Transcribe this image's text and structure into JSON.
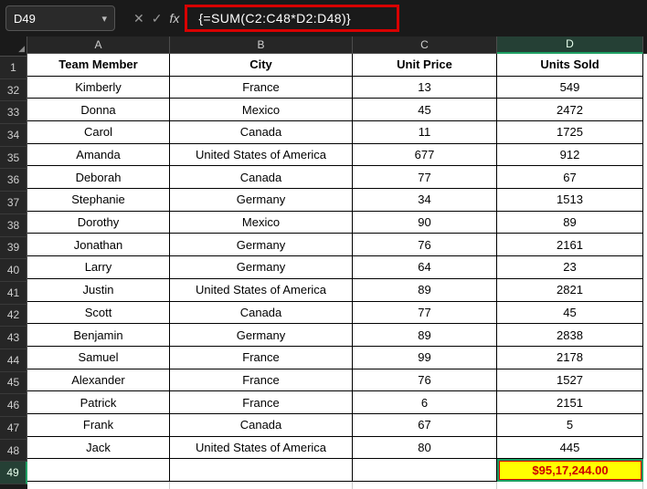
{
  "name_box": "D49",
  "fx_label": "fx",
  "formula": "{=SUM(C2:C48*D2:D48)}",
  "col_letters": [
    "A",
    "B",
    "C",
    "D"
  ],
  "row_header_first": "1",
  "row_headers_rest": [
    "32",
    "33",
    "34",
    "35",
    "36",
    "37",
    "38",
    "39",
    "40",
    "41",
    "42",
    "43",
    "44",
    "45",
    "46",
    "47",
    "48",
    "49"
  ],
  "table_headers": {
    "a": "Team Member",
    "b": "City",
    "c": "Unit Price",
    "d": "Units Sold"
  },
  "rows": [
    {
      "a": "Kimberly",
      "b": "France",
      "c": "13",
      "d": "549"
    },
    {
      "a": "Donna",
      "b": "Mexico",
      "c": "45",
      "d": "2472"
    },
    {
      "a": "Carol",
      "b": "Canada",
      "c": "11",
      "d": "1725"
    },
    {
      "a": "Amanda",
      "b": "United States of America",
      "c": "677",
      "d": "912"
    },
    {
      "a": "Deborah",
      "b": "Canada",
      "c": "77",
      "d": "67"
    },
    {
      "a": "Stephanie",
      "b": "Germany",
      "c": "34",
      "d": "1513"
    },
    {
      "a": "Dorothy",
      "b": "Mexico",
      "c": "90",
      "d": "89"
    },
    {
      "a": "Jonathan",
      "b": "Germany",
      "c": "76",
      "d": "2161"
    },
    {
      "a": "Larry",
      "b": "Germany",
      "c": "64",
      "d": "23"
    },
    {
      "a": "Justin",
      "b": "United States of America",
      "c": "89",
      "d": "2821"
    },
    {
      "a": "Scott",
      "b": "Canada",
      "c": "77",
      "d": "45"
    },
    {
      "a": "Benjamin",
      "b": "Germany",
      "c": "89",
      "d": "2838"
    },
    {
      "a": "Samuel",
      "b": "France",
      "c": "99",
      "d": "2178"
    },
    {
      "a": "Alexander",
      "b": "France",
      "c": "76",
      "d": "1527"
    },
    {
      "a": "Patrick",
      "b": "France",
      "c": "6",
      "d": "2151"
    },
    {
      "a": "Frank",
      "b": "Canada",
      "c": "67",
      "d": "5"
    },
    {
      "a": "Jack",
      "b": "United States of America",
      "c": "80",
      "d": "445"
    }
  ],
  "result_value": "$95,17,244.00",
  "active_cell": "D49",
  "colors": {
    "highlight_border": "#d80000",
    "result_bg": "#ffff00",
    "result_text": "#cc0000",
    "selection": "#1e9f63"
  }
}
